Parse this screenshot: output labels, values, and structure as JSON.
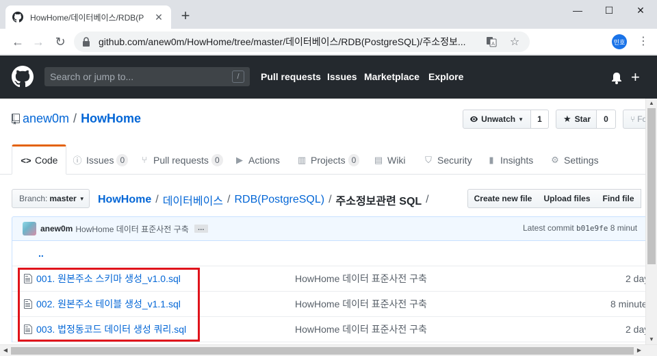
{
  "browser": {
    "tab_title": "HowHome/데이터베이스/RDB(P",
    "new_tab": "+",
    "url": "github.com/anew0m/HowHome/tree/master/데이터베이스/RDB(PostgreSQL)/주소정보...",
    "extension_badge": "15",
    "profile_initials": "민호"
  },
  "github_header": {
    "search_placeholder": "Search or jump to...",
    "search_shortcut": "/",
    "nav": [
      "Pull requests",
      "Issues",
      "Marketplace",
      "Explore"
    ]
  },
  "repo": {
    "owner": "anew0m",
    "separator": "/",
    "name": "HowHome",
    "watch_label": "Unwatch",
    "watch_count": "1",
    "star_label": "Star",
    "star_count": "0",
    "fork_label": "Fo"
  },
  "reponav": {
    "code": "Code",
    "issues": "Issues",
    "issues_count": "0",
    "pull_requests": "Pull requests",
    "pull_requests_count": "0",
    "actions": "Actions",
    "projects": "Projects",
    "projects_count": "0",
    "wiki": "Wiki",
    "security": "Security",
    "insights": "Insights",
    "settings": "Settings"
  },
  "file_nav": {
    "branch_prefix": "Branch:",
    "branch": "master",
    "breadcrumb": [
      "HowHome",
      "데이터베이스",
      "RDB(PostgreSQL)"
    ],
    "current_dir": "주소정보관련 SQL",
    "create_file": "Create new file",
    "upload_files": "Upload files",
    "find_file": "Find file"
  },
  "commit": {
    "author": "anew0m",
    "message": "HowHome 데이터 표준사전 구축",
    "ellipsis": "…",
    "latest_prefix": "Latest commit",
    "sha": "b01e9fe",
    "age": "8 minut"
  },
  "files": [
    {
      "name": "001. 원본주소 스키마 생성_v1.0.sql",
      "message": "HowHome 데이터 표준사전 구축",
      "age": "2 day"
    },
    {
      "name": "002. 원본주소 테이블 생성_v1.1.sql",
      "message": "HowHome 데이터 표준사전 구축",
      "age": "8 minute"
    },
    {
      "name": "003. 법정동코드 데이터 생성 쿼리.sql",
      "message": "HowHome 데이터 표준사전 구축",
      "age": "2 day"
    }
  ],
  "up_link": "..",
  "colors": {
    "highlight_border": "#e0131b",
    "github_dark": "#24292e",
    "link_blue": "#0366d6",
    "selected_tab_accent": "#e36209"
  }
}
